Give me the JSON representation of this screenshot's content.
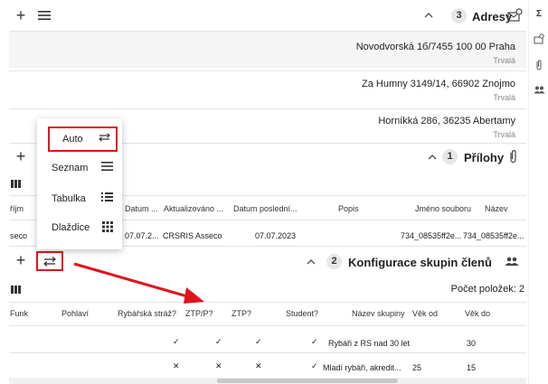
{
  "addresses": {
    "title": "Adresy",
    "count": "3",
    "items": [
      {
        "line": "Novodvorská 1б/7455 100 00 Praha",
        "type": "Trvalá"
      },
      {
        "line": "Za Humny 3149/14, 66902 Znojmo",
        "type": "Trvalá"
      },
      {
        "line": "Horníkká 286, 36235 Abertamy",
        "type": "Trvalá"
      }
    ]
  },
  "attachments": {
    "title": "Přílohy",
    "count": "1",
    "columns": [
      "Název",
      "Jméno souboru",
      "Popis",
      "Datum poslední...",
      "Aktualizováno ...",
      "Datum ..."
    ],
    "row": [
      "734_08535ff2e...",
      "734_08535ff2e...",
      "",
      "07.07.2023",
      "CRSRIS Asseco",
      "07.07.2..."
    ]
  },
  "view_menu": {
    "items": [
      {
        "label": "Auto"
      },
      {
        "label": "Seznam"
      },
      {
        "label": "Tabulka"
      },
      {
        "label": "Dlaždice"
      }
    ]
  },
  "groups": {
    "title": "Konfigurace skupin členů",
    "count": "2",
    "item_count": "Počet položek: 2",
    "columns": [
      "Věk do",
      "Věk od",
      "Název skupiny",
      "Student?",
      "ZTP?",
      "ZTP/P?",
      "Rybářská stráž?",
      "Pohlaví",
      "Funk"
    ],
    "rows": [
      {
        "vek_do": "30",
        "vek_od": "",
        "nazev": "Rybáři z RS nad 30 let",
        "student": "✓",
        "ztp": "✓",
        "ztpp": "✓",
        "straz": "✓"
      },
      {
        "vek_do": "15",
        "vek_od": "25",
        "nazev": "Mladí rybáři, akredit...",
        "student": "✓",
        "ztp": "✕",
        "ztpp": "✕",
        "straz": "✕"
      }
    ]
  },
  "colors": {
    "accent_red": "#e0141e"
  }
}
